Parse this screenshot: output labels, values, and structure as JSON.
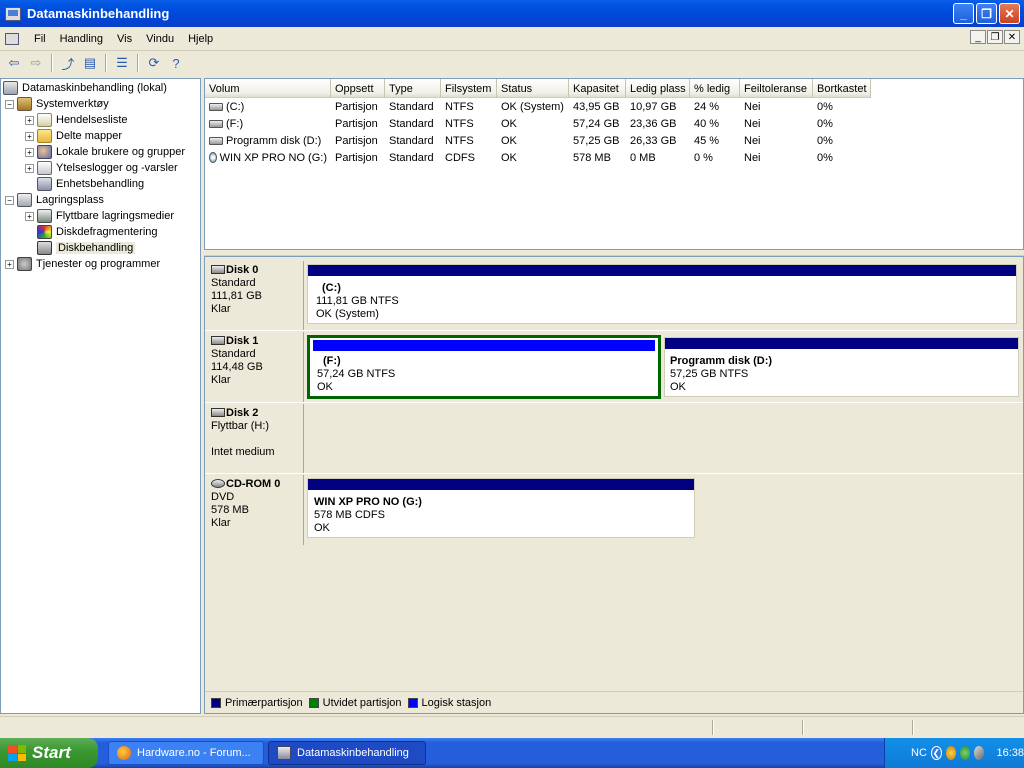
{
  "window": {
    "title": "Datamaskinbehandling"
  },
  "menu": [
    "Fil",
    "Handling",
    "Vis",
    "Vindu",
    "Hjelp"
  ],
  "tree": [
    {
      "label": "Datamaskinbehandling (lokal)",
      "icon": "computer-icon"
    },
    {
      "label": "Systemverktøy",
      "icon": "tools-icon"
    },
    {
      "label": "Hendelsesliste",
      "icon": "event-viewer-icon"
    },
    {
      "label": "Delte mapper",
      "icon": "shared-folders-icon"
    },
    {
      "label": "Lokale brukere og grupper",
      "icon": "users-icon"
    },
    {
      "label": "Ytelseslogger og -varsler",
      "icon": "performance-icon"
    },
    {
      "label": "Enhetsbehandling",
      "icon": "device-manager-icon"
    },
    {
      "label": "Lagringsplass",
      "icon": "storage-icon"
    },
    {
      "label": "Flyttbare lagringsmedier",
      "icon": "removable-storage-icon"
    },
    {
      "label": "Diskdefragmentering",
      "icon": "defrag-icon"
    },
    {
      "label": "Diskbehandling",
      "icon": "disk-management-icon"
    },
    {
      "label": "Tjenester og programmer",
      "icon": "services-icon"
    }
  ],
  "columns": [
    "Volum",
    "Oppsett",
    "Type",
    "Filsystem",
    "Status",
    "Kapasitet",
    "Ledig plass",
    "% ledig",
    "Feiltoleranse",
    "Bortkastet"
  ],
  "volumes": [
    [
      "(C:)",
      "Partisjon",
      "Standard",
      "NTFS",
      "OK (System)",
      "43,95 GB",
      "10,97 GB",
      "24 %",
      "Nei",
      "0%"
    ],
    [
      "(F:)",
      "Partisjon",
      "Standard",
      "NTFS",
      "OK",
      "57,24 GB",
      "23,36 GB",
      "40 %",
      "Nei",
      "0%"
    ],
    [
      "Programm disk (D:)",
      "Partisjon",
      "Standard",
      "NTFS",
      "OK",
      "57,25 GB",
      "26,33 GB",
      "45 %",
      "Nei",
      "0%"
    ],
    [
      "WIN XP PRO NO (G:)",
      "Partisjon",
      "Standard",
      "CDFS",
      "OK",
      "578 MB",
      "0 MB",
      "0 %",
      "Nei",
      "0%"
    ]
  ],
  "disks": [
    {
      "name": "Disk 0",
      "kind": "Standard",
      "size": "111,81 GB",
      "state": "Klar",
      "partitions": [
        {
          "title": "(C:)",
          "size": "111,81 GB NTFS",
          "status": "OK (System)"
        }
      ]
    },
    {
      "name": "Disk 1",
      "kind": "Standard",
      "size": "114,48 GB",
      "state": "Klar",
      "partitions": [
        {
          "title": "(F:)",
          "size": "57,24 GB NTFS",
          "status": "OK"
        },
        {
          "title": "Programm disk  (D:)",
          "size": "57,25 GB NTFS",
          "status": "OK"
        }
      ]
    },
    {
      "name": "Disk 2",
      "kind": "Flyttbar (H:)",
      "size": "",
      "state": "Intet medium",
      "partitions": []
    },
    {
      "name": "CD-ROM 0",
      "kind": "DVD",
      "size": "578 MB",
      "state": "Klar",
      "partitions": [
        {
          "title": "WIN XP PRO NO  (G:)",
          "size": "578 MB CDFS",
          "status": "OK"
        }
      ]
    }
  ],
  "legend": [
    {
      "label": "Primærpartisjon",
      "color": "#000080"
    },
    {
      "label": "Utvidet partisjon",
      "color": "#008000"
    },
    {
      "label": "Logisk stasjon",
      "color": "#0000ff"
    }
  ],
  "taskbar": {
    "start": "Start",
    "tasks": [
      "Hardware.no - Forum...",
      "Datamaskinbehandling"
    ],
    "lang": "NC",
    "clock": "16:38"
  }
}
